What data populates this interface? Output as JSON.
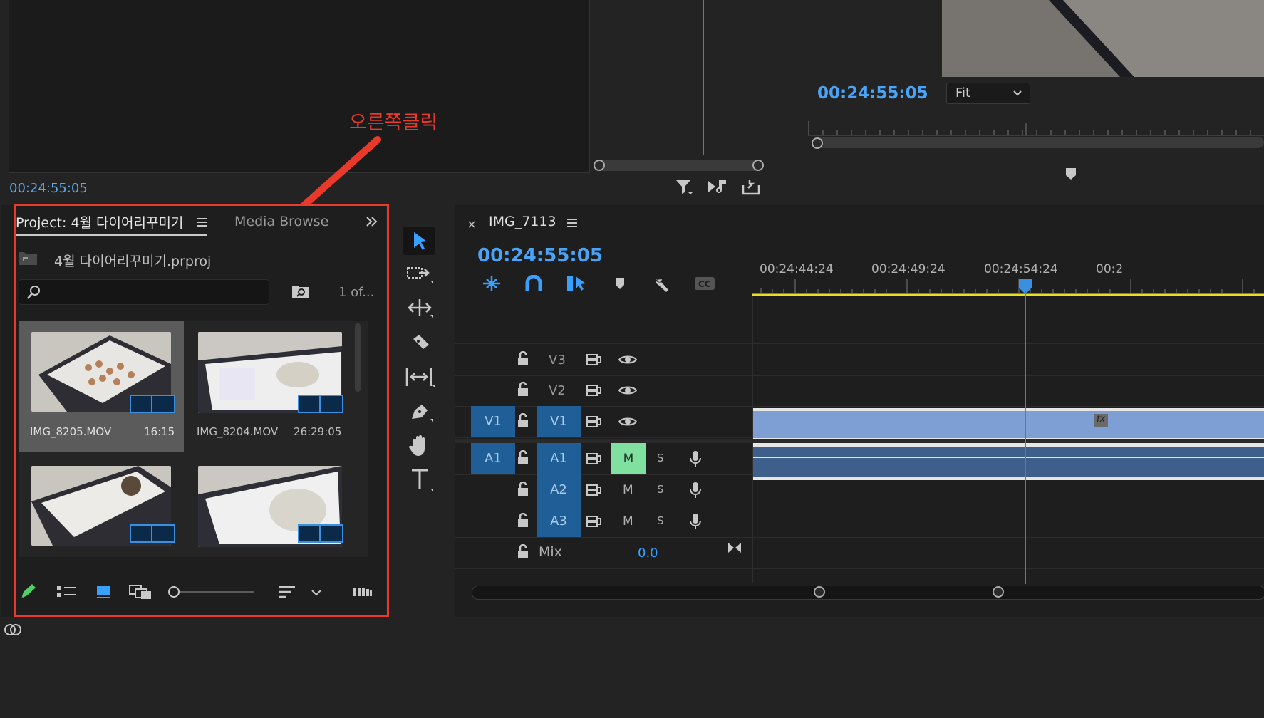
{
  "source_monitor": {
    "timecode": "00:24:55:05"
  },
  "program_monitor": {
    "timecode": "00:24:55:05",
    "zoom_select": "Fit"
  },
  "annotation": {
    "label": "오른쪽클릭"
  },
  "project_panel": {
    "tab_project": "Project: 4월 다이어리꾸미기",
    "tab_media_browser": "Media Browser",
    "overflow_icon": "double-chevron-right-icon",
    "project_file": "4월 다이어리꾸미기.prproj",
    "search_placeholder": "",
    "item_count": "1 of...",
    "clips": [
      {
        "name": "IMG_8205.MOV",
        "duration": "16:15"
      },
      {
        "name": "IMG_8204.MOV",
        "duration": "26:29:05"
      },
      {
        "name": "",
        "duration": ""
      },
      {
        "name": "",
        "duration": ""
      }
    ]
  },
  "tools": [
    "selection-tool",
    "track-select-tool",
    "ripple-edit-tool",
    "razor-tool",
    "slip-tool",
    "pen-tool",
    "hand-tool",
    "type-tool"
  ],
  "timeline": {
    "sequence_name": "IMG_7113",
    "timecode": "00:24:55:05",
    "ruler_labels": [
      "00:24:44:24",
      "00:24:49:24",
      "00:24:54:24",
      "00:2"
    ],
    "tracks": {
      "video": [
        {
          "label": "V3",
          "source": ""
        },
        {
          "label": "V2",
          "source": ""
        },
        {
          "label": "V1",
          "source": "V1"
        }
      ],
      "audio": [
        {
          "label": "A1",
          "source": "A1",
          "mute": "M",
          "solo": "S"
        },
        {
          "label": "A2",
          "source": "",
          "mute": "M",
          "solo": "S"
        },
        {
          "label": "A3",
          "source": "",
          "mute": "M",
          "solo": "S"
        }
      ],
      "mix_label": "Mix",
      "mix_value": "0.0"
    },
    "fx_badge": "fx"
  },
  "colors": {
    "accent_blue": "#3aa0ff",
    "highlight_red": "#e8392b",
    "mute_active": "#7fe0a0",
    "clip_video": "#7d9fd4",
    "clip_audio": "#3e5f8c"
  }
}
